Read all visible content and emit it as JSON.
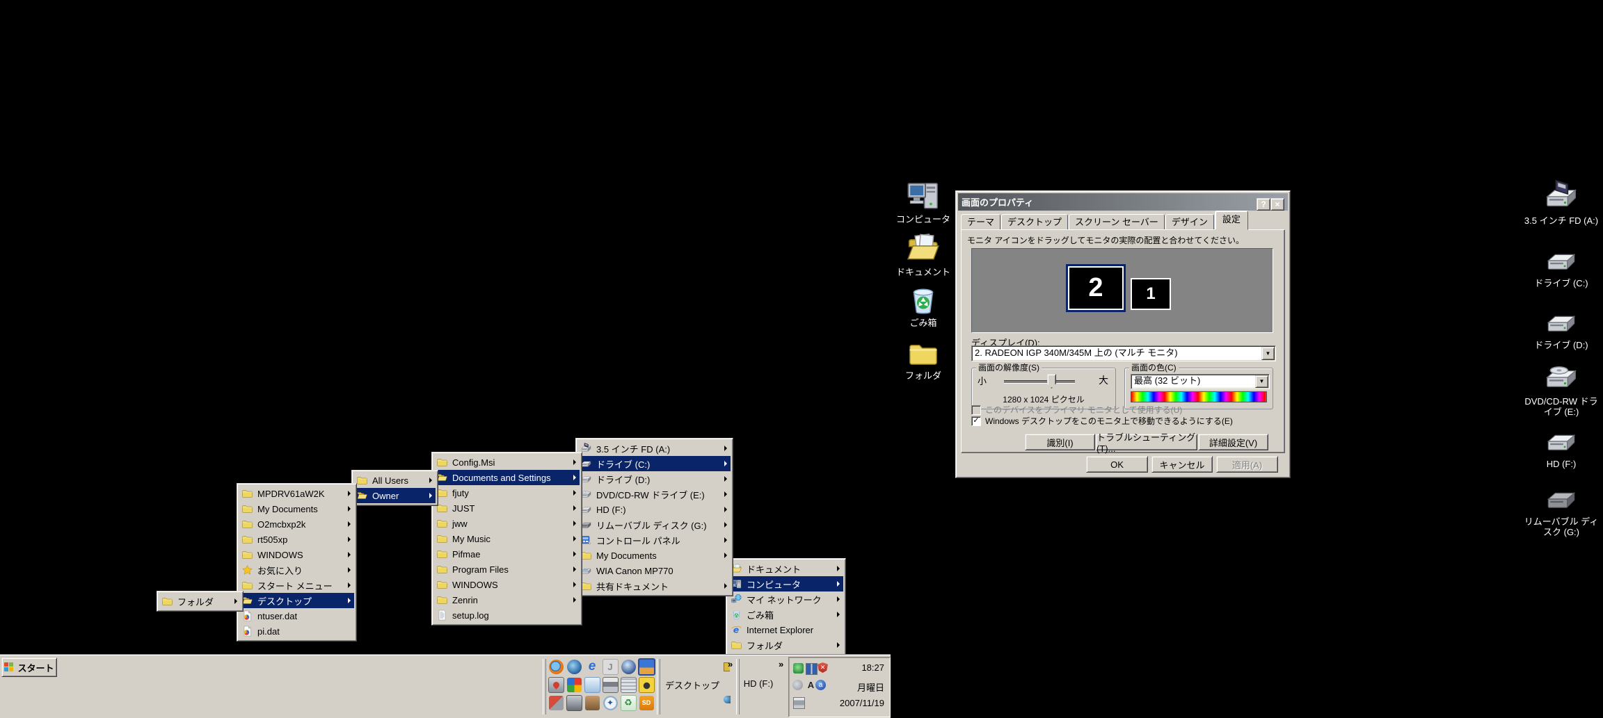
{
  "colors": {
    "desktop_bg": "#000000",
    "chrome": "#d4d0c8",
    "selection": "#0a246a",
    "title_gradient_left": "#53565a",
    "title_gradient_right": "#9aa0a6"
  },
  "desktop_icons": {
    "center": [
      {
        "label": "コンピュータ",
        "icon": "computer-icon"
      },
      {
        "label": "ドキュメント",
        "icon": "documents-icon"
      },
      {
        "label": "ごみ箱",
        "icon": "recycle-bin-icon"
      },
      {
        "label": "フォルダ",
        "icon": "folder-icon"
      }
    ],
    "right": [
      {
        "label": "3.5 インチ FD (A:)",
        "icon": "floppy-drive-icon"
      },
      {
        "label": "ドライブ (C:)",
        "icon": "hard-drive-icon"
      },
      {
        "label": "ドライブ (D:)",
        "icon": "hard-drive-icon"
      },
      {
        "label": "DVD/CD-RW ドライブ (E:)",
        "icon": "cd-drive-icon"
      },
      {
        "label": "HD (F:)",
        "icon": "hard-drive-icon"
      },
      {
        "label": "リムーバブル ディスク (G:)",
        "icon": "removable-disk-icon"
      }
    ]
  },
  "dialog": {
    "title": "画面のプロパティ",
    "help_button": "?",
    "close_button": "×",
    "tabs": [
      {
        "label": "テーマ",
        "active": false
      },
      {
        "label": "デスクトップ",
        "active": false
      },
      {
        "label": "スクリーン セーバー",
        "active": false
      },
      {
        "label": "デザイン",
        "active": false
      },
      {
        "label": "設定",
        "active": true
      }
    ],
    "instruction": "モニタ アイコンをドラッグしてモニタの実際の配置と合わせてください。",
    "monitors": [
      {
        "number": "2",
        "selected": true
      },
      {
        "number": "1",
        "selected": false
      }
    ],
    "display_label": "ディスプレイ(D):",
    "display_value": "2. RADEON IGP 340M/345M 上の (マルチ モニタ)",
    "resolution": {
      "group": "画面の解像度(S)",
      "small": "小",
      "large": "大",
      "value": "1280 x 1024 ピクセル"
    },
    "color_quality": {
      "group": "画面の色(C)",
      "value": "最高 (32 ビット)"
    },
    "checkbox_primary": {
      "label": "このデバイスをプライマリ モニタとして使用する(U)",
      "checked": false,
      "disabled": true
    },
    "checkbox_extend": {
      "label": "Windows デスクトップをこのモニタ上で移動できるようにする(E)",
      "checked": true,
      "disabled": false
    },
    "identify_button": "識別(I)",
    "troubleshoot_button": "トラブルシューティング(T)...",
    "advanced_button": "詳細設定(V)",
    "ok_button": "OK",
    "cancel_button": "キャンセル",
    "apply_button": "適用(A)"
  },
  "menus": {
    "desktop_folder_contents": {
      "items": [
        {
          "label": "フォルダ",
          "icon": "folder-icon",
          "has_submenu": true,
          "selected": false
        }
      ]
    },
    "owner_profile": {
      "items": [
        {
          "label": "MPDRV61aW2K",
          "icon": "folder-icon",
          "has_submenu": true,
          "selected": false
        },
        {
          "label": "My Documents",
          "icon": "folder-icon",
          "has_submenu": true,
          "selected": false
        },
        {
          "label": "O2mcbxp2k",
          "icon": "folder-icon",
          "has_submenu": true,
          "selected": false
        },
        {
          "label": "rt505xp",
          "icon": "folder-icon",
          "has_submenu": true,
          "selected": false
        },
        {
          "label": "WINDOWS",
          "icon": "folder-icon",
          "has_submenu": true,
          "selected": false
        },
        {
          "label": "お気に入り",
          "icon": "favorites-star-icon",
          "has_submenu": true,
          "selected": false
        },
        {
          "label": "スタート メニュー",
          "icon": "folder-icon",
          "has_submenu": true,
          "selected": false
        },
        {
          "label": "デスクトップ",
          "icon": "open-folder-icon",
          "has_submenu": true,
          "selected": true
        },
        {
          "label": "ntuser.dat",
          "icon": "dat-file-icon",
          "has_submenu": false,
          "selected": false
        },
        {
          "label": "pi.dat",
          "icon": "dat-file-icon",
          "has_submenu": false,
          "selected": false
        }
      ]
    },
    "documents_and_settings": {
      "items": [
        {
          "label": "All Users",
          "icon": "folder-icon",
          "has_submenu": true,
          "selected": false
        },
        {
          "label": "Owner",
          "icon": "open-folder-icon",
          "has_submenu": true,
          "selected": true
        }
      ]
    },
    "drive_c_contents": {
      "items": [
        {
          "label": "Config.Msi",
          "icon": "folder-icon",
          "has_submenu": true,
          "selected": false
        },
        {
          "label": "Documents and Settings",
          "icon": "open-folder-icon",
          "has_submenu": true,
          "selected": true
        },
        {
          "label": "fjuty",
          "icon": "folder-icon",
          "has_submenu": true,
          "selected": false
        },
        {
          "label": "JUST",
          "icon": "folder-icon",
          "has_submenu": true,
          "selected": false
        },
        {
          "label": "jww",
          "icon": "folder-icon",
          "has_submenu": true,
          "selected": false
        },
        {
          "label": "My Music",
          "icon": "folder-icon",
          "has_submenu": true,
          "selected": false
        },
        {
          "label": "Pifmae",
          "icon": "folder-icon",
          "has_submenu": true,
          "selected": false
        },
        {
          "label": "Program Files",
          "icon": "folder-icon",
          "has_submenu": true,
          "selected": false
        },
        {
          "label": "WINDOWS",
          "icon": "folder-icon",
          "has_submenu": true,
          "selected": false
        },
        {
          "label": "Zenrin",
          "icon": "folder-icon",
          "has_submenu": true,
          "selected": false
        },
        {
          "label": "setup.log",
          "icon": "log-file-icon",
          "has_submenu": false,
          "selected": false
        }
      ]
    },
    "computer_contents": {
      "items": [
        {
          "label": "3.5 インチ FD (A:)",
          "icon": "floppy-drive-icon",
          "has_submenu": true,
          "selected": false
        },
        {
          "label": "ドライブ (C:)",
          "icon": "hard-drive-icon",
          "has_submenu": true,
          "selected": true
        },
        {
          "label": "ドライブ (D:)",
          "icon": "hard-drive-icon",
          "has_submenu": true,
          "selected": false
        },
        {
          "label": "DVD/CD-RW ドライブ (E:)",
          "icon": "cd-drive-icon",
          "has_submenu": true,
          "selected": false
        },
        {
          "label": "HD (F:)",
          "icon": "hard-drive-icon",
          "has_submenu": true,
          "selected": false
        },
        {
          "label": "リムーバブル ディスク (G:)",
          "icon": "removable-disk-icon",
          "has_submenu": true,
          "selected": false
        },
        {
          "label": "コントロール パネル",
          "icon": "control-panel-icon",
          "has_submenu": true,
          "selected": false
        },
        {
          "label": "My Documents",
          "icon": "folder-icon",
          "has_submenu": true,
          "selected": false
        },
        {
          "label": "WIA Canon MP770",
          "icon": "scanner-icon",
          "has_submenu": false,
          "selected": false
        },
        {
          "label": "共有ドキュメント",
          "icon": "folder-icon",
          "has_submenu": true,
          "selected": false
        }
      ]
    },
    "desktop_toolbar_menu": {
      "items": [
        {
          "label": "ドキュメント",
          "icon": "documents-icon",
          "has_submenu": true,
          "selected": false
        },
        {
          "label": "コンピュータ",
          "icon": "computer-icon",
          "has_submenu": true,
          "selected": true
        },
        {
          "label": "マイ ネットワーク",
          "icon": "network-icon",
          "has_submenu": true,
          "selected": false
        },
        {
          "label": "ごみ箱",
          "icon": "recycle-bin-icon",
          "has_submenu": true,
          "selected": false
        },
        {
          "label": "Internet Explorer",
          "icon": "internet-explorer-icon",
          "has_submenu": false,
          "selected": false
        },
        {
          "label": "フォルダ",
          "icon": "folder-icon",
          "has_submenu": true,
          "selected": false
        }
      ]
    }
  },
  "taskbar": {
    "start_label": "スタート",
    "quick_launch_icons": [
      "firefox-icon",
      "thunderbird-icon",
      "internet-explorer-icon",
      "j-app-icon",
      "google-earth-icon",
      "image-viewer-icon",
      "pc-health-icon",
      "color-cube-icon",
      "blue-document-icon",
      "printer-icon",
      "calculator-icon",
      "yellow-camera-icon",
      "red-media-icon",
      "scanner-icon",
      "brown-app-icon",
      "compass-icon",
      "green-recycle-icon",
      "sd-app-icon"
    ],
    "desktop_toolbar_label": "デスクトップ",
    "hd_toolbar_label": "HD (F:)",
    "chevron": "»",
    "tray": {
      "icons": [
        "safely-remove-icon",
        "display-settings-icon",
        "security-alert-icon",
        "volume-icon",
        "ime-caps-icon",
        "ime-input-icon",
        "printer-status-icon"
      ],
      "time": "18:27",
      "day": "月曜日",
      "date": "2007/11/19"
    }
  }
}
